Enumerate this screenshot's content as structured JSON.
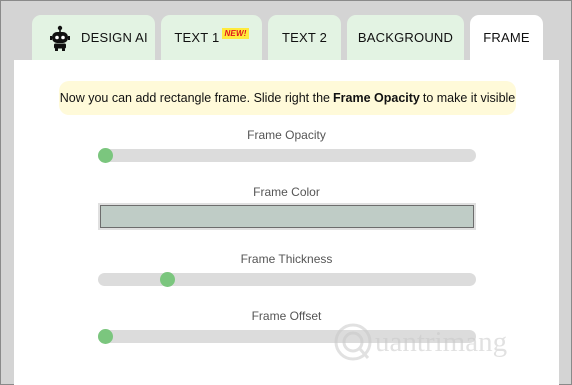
{
  "tabs": [
    {
      "label": "DESIGN AI",
      "active": false
    },
    {
      "label": "TEXT 1",
      "badge": "NEW!",
      "active": false
    },
    {
      "label": "TEXT 2",
      "active": false
    },
    {
      "label": "BACKGROUND",
      "active": false
    },
    {
      "label": "FRAME",
      "active": true
    }
  ],
  "hint": {
    "before": "Now you can add rectangle frame. Slide right the",
    "bold": "Frame Opacity",
    "after": "to make it visible"
  },
  "controls": {
    "frame_opacity": {
      "label": "Frame Opacity",
      "value": 0.0
    },
    "frame_color": {
      "label": "Frame Color",
      "value": "#bfccc6"
    },
    "frame_thickness": {
      "label": "Frame Thickness",
      "value": 0.17
    },
    "frame_offset": {
      "label": "Frame Offset",
      "value": 0.0
    }
  },
  "watermark": {
    "text": "uantrimang"
  },
  "colors": {
    "tab_bg": "#e3f3e3",
    "tab_active_bg": "#ffffff",
    "hint_bg": "#fffad9",
    "slider_track": "#dcdcdc",
    "slider_knob": "#7bc67e",
    "page_bg": "#d4d4d4"
  },
  "icons": {
    "design_ai": "robot-icon"
  }
}
